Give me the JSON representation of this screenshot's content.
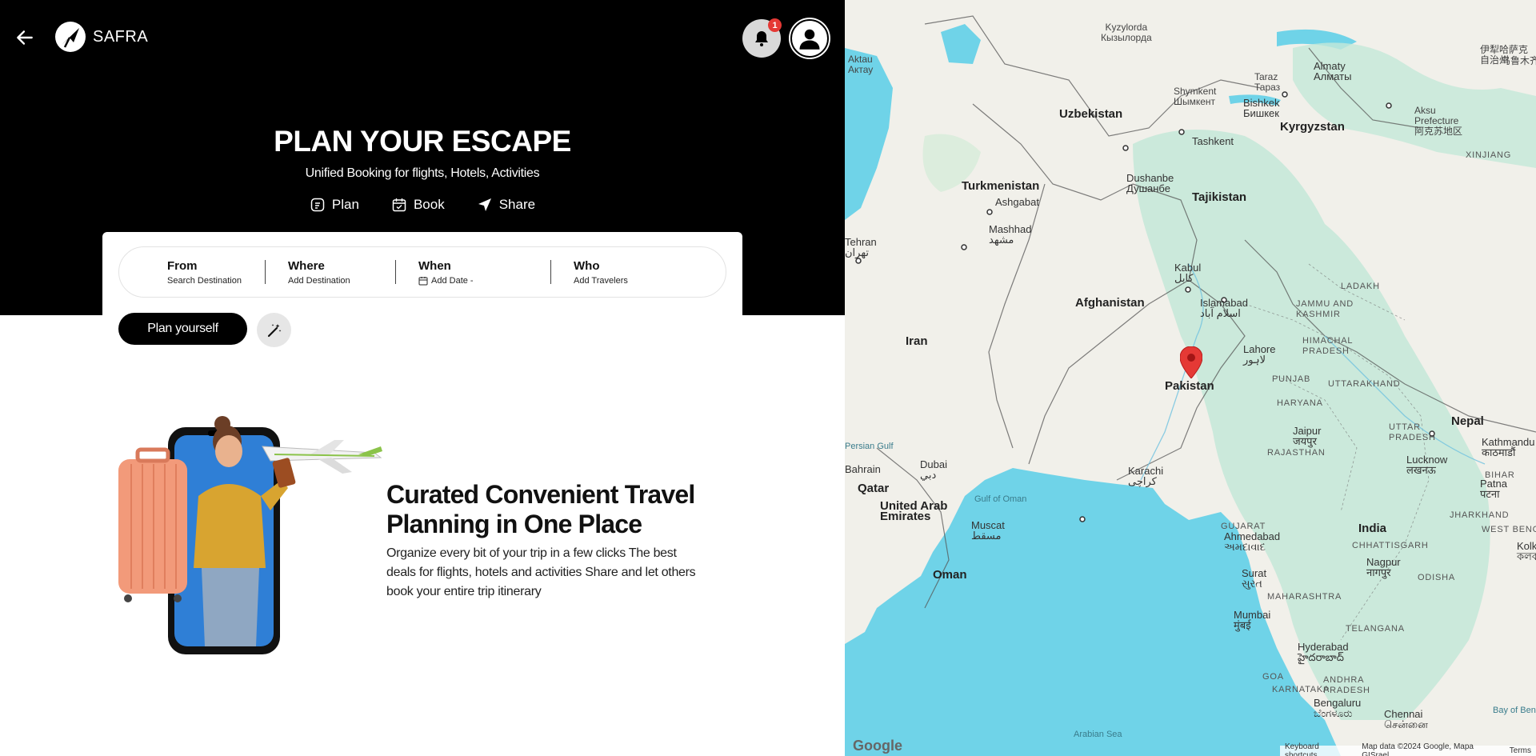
{
  "header": {
    "brand": "SAFRA",
    "notification_count": "1"
  },
  "hero": {
    "title": "PLAN YOUR ESCAPE",
    "subtitle": "Unified Booking for flights, Hotels, Activities",
    "features": [
      {
        "label": "Plan",
        "icon": "plan-icon"
      },
      {
        "label": "Book",
        "icon": "calendar-check-icon"
      },
      {
        "label": "Share",
        "icon": "send-icon"
      }
    ]
  },
  "search": {
    "from_label": "From",
    "from_sub": "Search Destination",
    "where_label": "Where",
    "where_sub": "Add Destination",
    "when_label": "When",
    "when_sub": "Add Date -",
    "who_label": "Who",
    "who_sub": "Add Travelers"
  },
  "actions": {
    "plan_yourself": "Plan yourself",
    "magic_icon": "magic-wand-icon"
  },
  "feature": {
    "title": "Curated Convenient Travel Planning in One Place",
    "description": "Organize every bit of your trip in a few clicks The best deals for flights, hotels and activities Share and let others book your entire trip itinerary"
  },
  "map": {
    "labels": {
      "kyzylorda": "Kyzylorda",
      "kyzylorda_local": "Кызылорда",
      "aktau": "Aktau",
      "aktau_local": "Актау",
      "taraz": "Taraz",
      "taraz_local": "Тараз",
      "almaty": "Almaty",
      "almaty_local": "Алматы",
      "shymkent": "Shymkent",
      "shymkent_local": "Шымкент",
      "bishkek": "Bishkek",
      "bishkek_local": "Бишкек",
      "aksu": "Aksu",
      "aksu_local": "Prefecture",
      "aksu_cn": "阿克苏地区",
      "yili": "伊犁哈萨克",
      "yili2": "自治州",
      "urumqi": "乌鲁木齐",
      "uzbekistan": "Uzbekistan",
      "kyrgyzstan": "Kyrgyzstan",
      "tashkent": "Tashkent",
      "xinjiang": "XINJIANG",
      "turkmenistan": "Turkmenistan",
      "dushanbe": "Dushanbe",
      "dushanbe_local": "Душанбе",
      "tajikistan": "Tajikistan",
      "ashgabat": "Ashgabat",
      "mashhad": "Mashhad",
      "mashhad_local": "مشهد",
      "tehran": "Tehran",
      "tehran_local": "تهران",
      "kabul": "Kabul",
      "kabul_local": "کابل",
      "islamabad": "Islamabad",
      "islamabad_local": "اسلام آباد",
      "jammu": "JAMMU AND",
      "kashmir": "KASHMIR",
      "ladakh": "LADAKH",
      "afghanistan": "Afghanistan",
      "iran": "Iran",
      "himachal": "HIMACHAL",
      "himachal2": "PRADESH",
      "lahore": "Lahore",
      "lahore_local": "لاہور",
      "pakistan": "Pakistan",
      "punjab": "PUNJAB",
      "uttarakhand": "UTTARAKHAND",
      "haryana": "HARYANA",
      "nepal": "Nepal",
      "kathmandu": "Kathmandu",
      "kathmandu_local": "काठमाडौं",
      "persian_gulf": "Persian Gulf",
      "jaipur": "Jaipur",
      "jaipur_local": "जयपुर",
      "uttar": "UTTAR",
      "uttar2": "PRADESH",
      "bahrain": "Bahrain",
      "rajasthan": "RAJASTHAN",
      "lucknow": "Lucknow",
      "lucknow_local": "लखनऊ",
      "bihar": "BIHAR",
      "dubai": "Dubai",
      "dubai_local": "دبي",
      "qatar": "Qatar",
      "karachi": "Karachi",
      "karachi_local": "کراچی",
      "patna": "Patna",
      "patna_local": "पटना",
      "gulf_oman": "Gulf of Oman",
      "uae1": "United Arab",
      "uae2": "Emirates",
      "muscat": "Muscat",
      "muscat_local": "مسقط",
      "gujarat": "GUJARAT",
      "jharkhand": "JHARKHAND",
      "ahmedabad": "Ahmedabad",
      "ahmedabad_local": "અમદાવાદ",
      "india": "India",
      "west_beng": "WEST BENG",
      "chhattisgarh": "CHHATTISGARH",
      "kolk": "Kolk",
      "kolk_local": "কলক",
      "nagpur": "Nagpur",
      "nagpur_local": "नागपुर",
      "oman": "Oman",
      "surat": "Surat",
      "surat_local": "સુરત",
      "odisha": "ODISHA",
      "maharashtra": "MAHARASHTRA",
      "mumbai": "Mumbai",
      "mumbai_local": "मुंबई",
      "telangana": "TELANGANA",
      "hyderabad": "Hyderabad",
      "hyderabad_local": "హైదరాబాద్",
      "goa": "GOA",
      "andhra": "ANDHRA",
      "andhra2": "PRADESH",
      "karnataka": "KARNATAKA",
      "bengaluru": "Bengaluru",
      "bengaluru_local": "ಬೆಂಗಳೂರು",
      "chennai": "Chennai",
      "chennai_local": "சென்னை",
      "bay": "Bay of Ben",
      "arabian": "Arabian Sea"
    },
    "attribution": {
      "google": "Google",
      "shortcuts": "Keyboard shortcuts",
      "data": "Map data ©2024 Google, Mapa GISrael",
      "terms": "Terms"
    },
    "colors": {
      "water": "#6fd3e8",
      "land": "#f1f0ea",
      "green": "#c4e8d8",
      "pin": "#e53935"
    }
  }
}
